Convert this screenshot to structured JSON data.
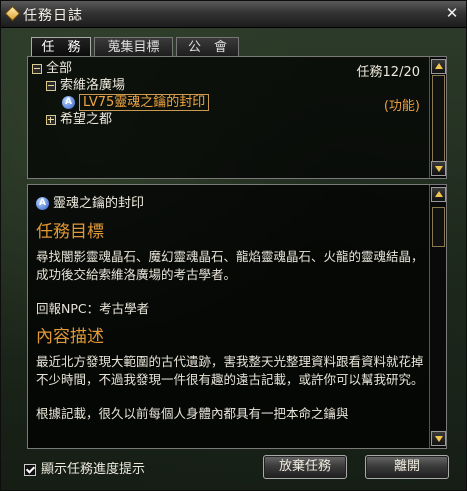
{
  "window": {
    "title": "任務日誌",
    "close_label": "✕"
  },
  "tabs": [
    {
      "label": "任　務",
      "active": true
    },
    {
      "label": "蒐集目標",
      "active": false
    },
    {
      "label": "公　會",
      "active": false
    }
  ],
  "tree": {
    "count_label": "任務12/20",
    "root": "全部",
    "region1": "索維洛廣場",
    "quest_icon_letter": "A",
    "quest": "LV75靈魂之鑰的封印",
    "quest_tag": "(功能)",
    "region2": "希望之都"
  },
  "detail": {
    "quest_title": "靈魂之鑰的封印",
    "objective_heading": "任務目標",
    "objective_text": "尋找闇影靈魂晶石、魔幻靈魂晶石、龍焰靈魂晶石、火龍的靈魂結晶，成功後交給索維洛廣場的考古學者。",
    "npc_text": "回報NPC：考古學者",
    "desc_heading": "內容描述",
    "desc_text1": "最近北方發現大範圍的古代遺跡，害我整天光整理資料跟看資料就花掉不少時間，不過我發現一件很有趣的遠古記載，或許你可以幫我研究。",
    "desc_text2": "根據記載，很久以前每個人身體內都具有一把本命之鑰與"
  },
  "footer": {
    "checkbox_label": "顯示任務進度提示",
    "checkbox_checked": true,
    "abandon_button": "放棄任務",
    "leave_button": "離開"
  },
  "colors": {
    "accent": "#e09838",
    "selected_quest": "#f1a542"
  }
}
